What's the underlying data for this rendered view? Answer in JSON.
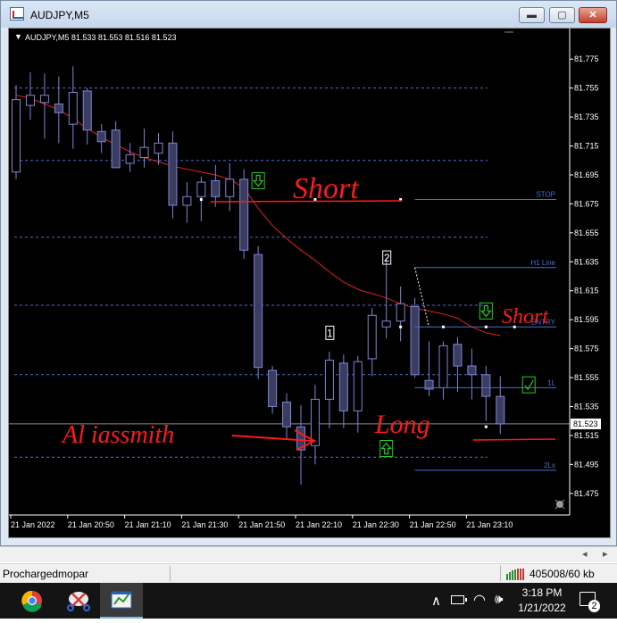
{
  "window": {
    "title": "AUDJPY,M5",
    "buttons": {
      "minimize": "▬",
      "maximize": "▢",
      "close": "✕"
    }
  },
  "chart_header": {
    "arrow": "▼",
    "text": "AUDJPY,M5  81.533 81.553 81.516 81.523"
  },
  "colors": {
    "background": "#000000",
    "candle_outline": "#7f84d6",
    "candle_bull_fill": "#000000",
    "candle_bear_fill": "#3a3d60",
    "moving_average": "#e02020",
    "levels": "#4a6fd0",
    "annotations": "#ff1a1a",
    "arrows": "#22d022",
    "price_line": "#8a8a8a"
  },
  "chart_data": {
    "type": "candlestick",
    "symbol": "AUDJPY",
    "timeframe": "M5",
    "ylim": [
      81.465,
      81.785
    ],
    "y_ticks": [
      "81.775",
      "81.755",
      "81.735",
      "81.715",
      "81.695",
      "81.675",
      "81.655",
      "81.635",
      "81.615",
      "81.595",
      "81.575",
      "81.555",
      "81.535",
      "81.515",
      "81.495",
      "81.475"
    ],
    "current_price": "81.523",
    "x_ticks": [
      "21 Jan 2022",
      "21 Jan 20:50",
      "21 Jan 21:10",
      "21 Jan 21:30",
      "21 Jan 21:50",
      "21 Jan 22:10",
      "21 Jan 22:30",
      "21 Jan 22:50",
      "21 Jan 23:10"
    ],
    "x_tick_index": [
      0,
      4,
      8,
      12,
      16,
      20,
      24,
      28,
      32
    ],
    "candles": [
      {
        "o": 81.697,
        "h": 81.757,
        "l": 81.692,
        "c": 81.747
      },
      {
        "o": 81.743,
        "h": 81.766,
        "l": 81.733,
        "c": 81.75
      },
      {
        "o": 81.745,
        "h": 81.765,
        "l": 81.72,
        "c": 81.75
      },
      {
        "o": 81.744,
        "h": 81.763,
        "l": 81.717,
        "c": 81.738
      },
      {
        "o": 81.73,
        "h": 81.77,
        "l": 81.713,
        "c": 81.752
      },
      {
        "o": 81.753,
        "h": 81.755,
        "l": 81.716,
        "c": 81.726
      },
      {
        "o": 81.725,
        "h": 81.73,
        "l": 81.71,
        "c": 81.718
      },
      {
        "o": 81.726,
        "h": 81.732,
        "l": 81.7,
        "c": 81.7
      },
      {
        "o": 81.703,
        "h": 81.717,
        "l": 81.697,
        "c": 81.709
      },
      {
        "o": 81.707,
        "h": 81.727,
        "l": 81.7,
        "c": 81.714
      },
      {
        "o": 81.71,
        "h": 81.724,
        "l": 81.702,
        "c": 81.717
      },
      {
        "o": 81.717,
        "h": 81.725,
        "l": 81.665,
        "c": 81.674
      },
      {
        "o": 81.674,
        "h": 81.69,
        "l": 81.662,
        "c": 81.68
      },
      {
        "o": 81.68,
        "h": 81.694,
        "l": 81.663,
        "c": 81.69
      },
      {
        "o": 81.691,
        "h": 81.702,
        "l": 81.673,
        "c": 81.68
      },
      {
        "o": 81.68,
        "h": 81.703,
        "l": 81.67,
        "c": 81.692
      },
      {
        "o": 81.692,
        "h": 81.699,
        "l": 81.637,
        "c": 81.643
      },
      {
        "o": 81.64,
        "h": 81.646,
        "l": 81.554,
        "c": 81.562
      },
      {
        "o": 81.56,
        "h": 81.563,
        "l": 81.53,
        "c": 81.535
      },
      {
        "o": 81.538,
        "h": 81.544,
        "l": 81.513,
        "c": 81.521
      },
      {
        "o": 81.521,
        "h": 81.536,
        "l": 81.481,
        "c": 81.505
      },
      {
        "o": 81.508,
        "h": 81.55,
        "l": 81.495,
        "c": 81.54
      },
      {
        "o": 81.54,
        "h": 81.573,
        "l": 81.52,
        "c": 81.567
      },
      {
        "o": 81.565,
        "h": 81.571,
        "l": 81.52,
        "c": 81.532
      },
      {
        "o": 81.532,
        "h": 81.57,
        "l": 81.517,
        "c": 81.566
      },
      {
        "o": 81.568,
        "h": 81.603,
        "l": 81.556,
        "c": 81.598
      },
      {
        "o": 81.59,
        "h": 81.638,
        "l": 81.582,
        "c": 81.594
      },
      {
        "o": 81.594,
        "h": 81.618,
        "l": 81.58,
        "c": 81.606
      },
      {
        "o": 81.604,
        "h": 81.61,
        "l": 81.555,
        "c": 81.557
      },
      {
        "o": 81.553,
        "h": 81.58,
        "l": 81.542,
        "c": 81.547
      },
      {
        "o": 81.548,
        "h": 81.58,
        "l": 81.54,
        "c": 81.577
      },
      {
        "o": 81.578,
        "h": 81.583,
        "l": 81.545,
        "c": 81.563
      },
      {
        "o": 81.563,
        "h": 81.575,
        "l": 81.54,
        "c": 81.557
      },
      {
        "o": 81.557,
        "h": 81.563,
        "l": 81.525,
        "c": 81.542
      },
      {
        "o": 81.542,
        "h": 81.556,
        "l": 81.516,
        "c": 81.523
      }
    ],
    "moving_average": [
      81.75,
      81.748,
      81.744,
      81.74,
      81.734,
      81.727,
      81.721,
      81.716,
      81.711,
      81.707,
      81.704,
      81.701,
      81.699,
      81.697,
      81.695,
      81.692,
      81.686,
      81.672,
      81.66,
      81.651,
      81.643,
      81.636,
      81.628,
      81.621,
      81.616,
      81.613,
      81.61,
      81.606,
      81.603,
      81.601,
      81.599,
      81.596,
      81.59,
      81.586,
      81.584
    ],
    "dashed_levels": [
      81.755,
      81.705,
      81.652,
      81.605,
      81.557,
      81.5
    ],
    "tool_lines": [
      {
        "label": "STOP",
        "price": 81.678,
        "from": 28
      },
      {
        "label": "H1 Line",
        "price": 81.631,
        "from": 28
      },
      {
        "label": "ENTRY",
        "price": 81.59,
        "from": 28
      },
      {
        "label": "1L",
        "price": 81.548,
        "from": 28
      },
      {
        "label": "2Ls",
        "price": 81.491,
        "from": 28
      }
    ],
    "wave_labels": [
      {
        "text": "1",
        "index": 22,
        "price": 81.585
      },
      {
        "text": "2",
        "index": 26,
        "price": 81.637
      }
    ],
    "signal_arrows": [
      {
        "direction": "down",
        "index": 17,
        "price": 81.691
      },
      {
        "direction": "down",
        "index": 33,
        "price": 81.601
      },
      {
        "direction": "up",
        "index": 26,
        "price": 81.506
      },
      {
        "direction": "check",
        "index": 36,
        "price": 81.55
      }
    ]
  },
  "annotations": {
    "short_top": "Short",
    "short_right": "Short",
    "long": "Long",
    "signature": "Al iassmith"
  },
  "status_bar": {
    "profile": "Prochargedmopar",
    "traffic": "405008/60 kb"
  },
  "taskbar": {
    "apps": [
      "chrome-icon",
      "snipping-tool-icon",
      "metatrader-icon"
    ],
    "time": "3:18 PM",
    "date": "1/21/2022",
    "notification_count": "2"
  }
}
